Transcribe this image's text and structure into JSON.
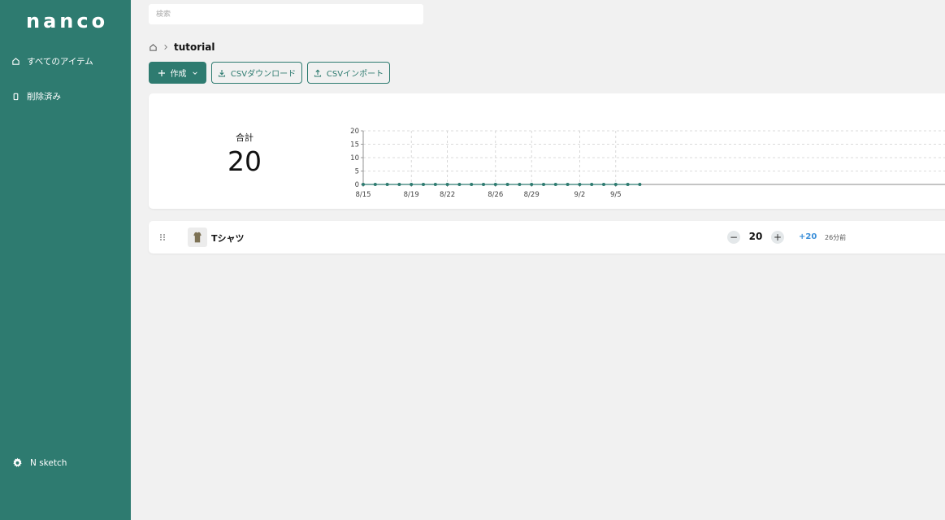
{
  "app": {
    "logo": "nanco"
  },
  "sidebar": {
    "items": [
      {
        "label": "すべてのアイテム",
        "icon": "home-icon"
      },
      {
        "label": "削除済み",
        "icon": "trash-icon"
      }
    ],
    "footer": {
      "label": "N sketch",
      "icon": "gear-icon"
    }
  },
  "search": {
    "placeholder": "検索",
    "value": ""
  },
  "breadcrumb": {
    "home_icon": "home-icon",
    "separator_icon": "chevron-right-icon",
    "current": "tutorial"
  },
  "toolbar": {
    "create_label": "作成",
    "csv_download_label": "CSVダウンロード",
    "csv_import_label": "CSVインポート"
  },
  "summary": {
    "total_label": "合計",
    "total_value": "20"
  },
  "chart_data": {
    "type": "line",
    "x": [
      "8/15",
      "8/16",
      "8/17",
      "8/18",
      "8/19",
      "8/20",
      "8/21",
      "8/22",
      "8/23",
      "8/24",
      "8/25",
      "8/26",
      "8/27",
      "8/28",
      "8/29",
      "8/30",
      "8/31",
      "9/1",
      "9/2",
      "9/3",
      "9/4",
      "9/5",
      "9/6",
      "9/7"
    ],
    "x_tick_labels": [
      "8/15",
      "8/19",
      "8/22",
      "8/26",
      "8/29",
      "9/2",
      "9/5"
    ],
    "y_ticks": [
      0,
      5,
      10,
      15,
      20
    ],
    "ylim": [
      0,
      20
    ],
    "series": [
      {
        "values": [
          0,
          0,
          0,
          0,
          0,
          0,
          0,
          0,
          0,
          0,
          0,
          0,
          0,
          0,
          0,
          0,
          0,
          0,
          0,
          0,
          0,
          0,
          0,
          0
        ]
      }
    ],
    "grid": true,
    "line_color": "#2e7b70"
  },
  "items": [
    {
      "name": "Tシャツ",
      "quantity": "20",
      "delta": "+20",
      "updated": "26分前"
    }
  ],
  "colors": {
    "primary": "#2e7b70",
    "delta": "#3b8fd9",
    "background": "#f1f1f1"
  }
}
